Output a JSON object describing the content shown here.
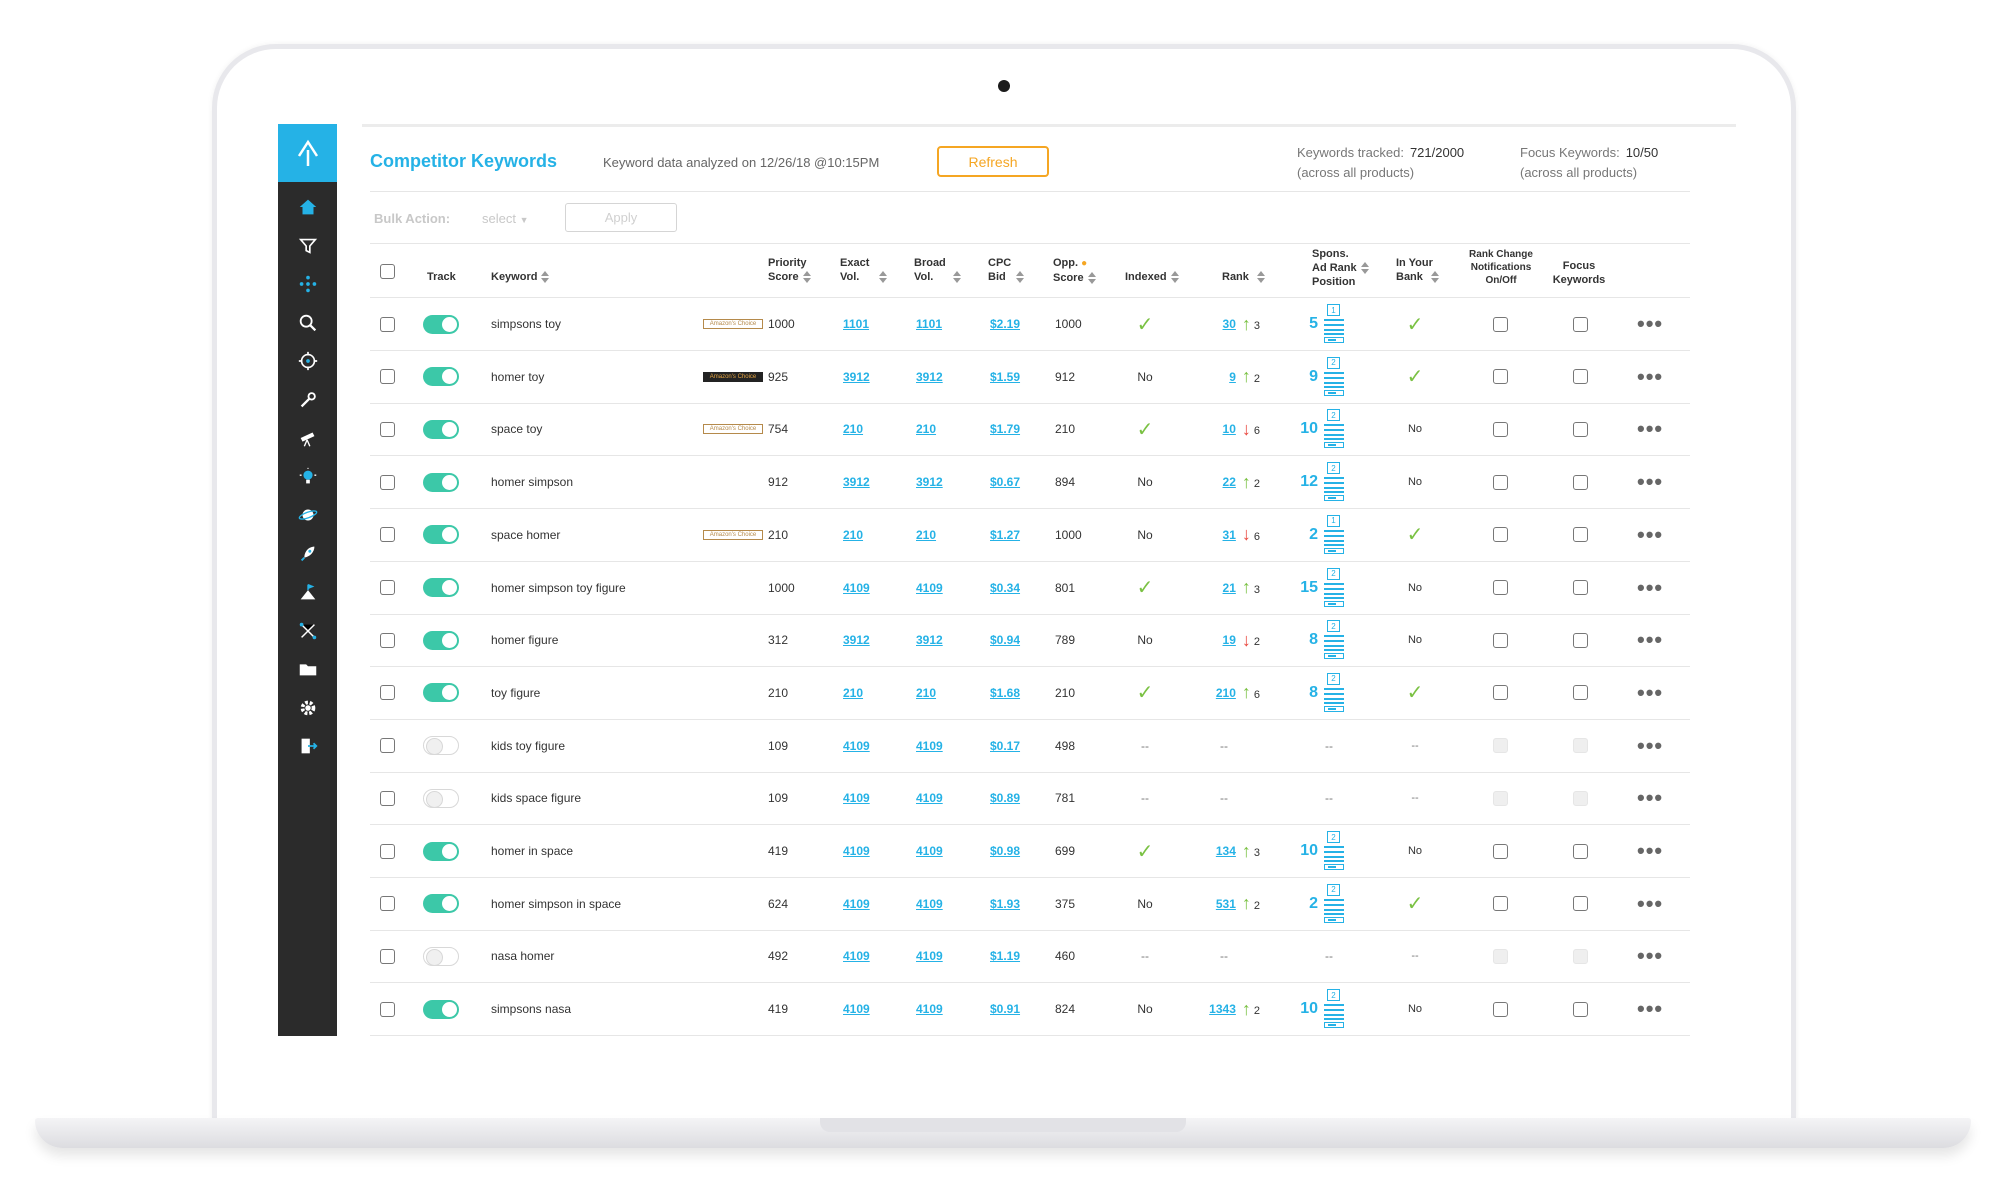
{
  "app": {
    "title": "Competitor Keywords",
    "analyzed": "Keyword data analyzed on 12/26/18 @10:15PM",
    "refresh_label": "Refresh",
    "keywords_tracked_label": "Keywords tracked:",
    "keywords_tracked_value": "721/2000",
    "keywords_tracked_note": "(across all products)",
    "focus_keywords_label": "Focus Keywords:",
    "focus_keywords_value": "10/50",
    "focus_keywords_note": "(across all products)",
    "bulk_action_label": "Bulk Action:",
    "bulk_select_label": "select",
    "apply_label": "Apply"
  },
  "colors": {
    "accent": "#25b2e6",
    "toggle_on": "#3cc8a8",
    "refresh": "#f5a623",
    "check": "#7ac143",
    "down": "#e8453c",
    "sidebar": "#2b2b2b"
  },
  "sidebar_icons": [
    "logo-icon",
    "home-icon",
    "funnel-icon",
    "diamond-dots-icon",
    "search-icon",
    "crosshair-icon",
    "wrench-icon",
    "telescope-icon",
    "lightbulb-icon",
    "planet-icon",
    "rocket-icon",
    "flag-icon",
    "network-icon",
    "folder-icon",
    "gear-icon",
    "logout-icon"
  ],
  "headers": {
    "track": "Track",
    "keyword": "Keyword",
    "priority_1": "Priority",
    "priority_2": "Score",
    "exact_1": "Exact",
    "exact_2": "Vol.",
    "broad_1": "Broad",
    "broad_2": "Vol.",
    "cpc_1": "CPC",
    "cpc_2": "Bid",
    "opp_1": "Opp.",
    "opp_2": "Score",
    "indexed": "Indexed",
    "rank": "Rank",
    "spons_1": "Spons.",
    "spons_2": "Ad Rank",
    "spons_3": "Position",
    "bank_1": "In Your",
    "bank_2": "Bank",
    "notif_1": "Rank Change",
    "notif_2": "Notifications",
    "notif_3": "On/Off",
    "focus_1": "Focus",
    "focus_2": "Keywords"
  },
  "badge_text": "Amazon's Choice",
  "rows": [
    {
      "track": true,
      "keyword": "simpsons toy",
      "badge": "light",
      "priority": "1000",
      "exact": "1101",
      "broad": "1101",
      "cpc": "$2.19",
      "opp": "1000",
      "indexed": "check",
      "rank": "30",
      "dir": "up",
      "delta": "3",
      "spons": "5",
      "pos": "1",
      "bank": "check"
    },
    {
      "track": true,
      "keyword": "homer toy",
      "badge": "dark",
      "priority": "925",
      "exact": "3912",
      "broad": "3912",
      "cpc": "$1.59",
      "opp": "912",
      "indexed": "No",
      "rank": "9",
      "dir": "up",
      "delta": "2",
      "spons": "9",
      "pos": "2",
      "bank": "check"
    },
    {
      "track": true,
      "keyword": "space toy",
      "badge": "light",
      "priority": "754",
      "exact": "210",
      "broad": "210",
      "cpc": "$1.79",
      "opp": "210",
      "indexed": "check",
      "rank": "10",
      "dir": "down",
      "delta": "6",
      "spons": "10",
      "pos": "2",
      "bank": "No"
    },
    {
      "track": true,
      "keyword": "homer simpson",
      "badge": "",
      "priority": "912",
      "exact": "3912",
      "broad": "3912",
      "cpc": "$0.67",
      "opp": "894",
      "indexed": "No",
      "rank": "22",
      "dir": "up",
      "delta": "2",
      "spons": "12",
      "pos": "2",
      "bank": "No"
    },
    {
      "track": true,
      "keyword": "space homer",
      "badge": "light",
      "priority": "210",
      "exact": "210",
      "broad": "210",
      "cpc": "$1.27",
      "opp": "1000",
      "indexed": "No",
      "rank": "31",
      "dir": "down",
      "delta": "6",
      "spons": "2",
      "pos": "1",
      "bank": "check"
    },
    {
      "track": true,
      "keyword": "homer simpson toy figure",
      "badge": "",
      "priority": "1000",
      "exact": "4109",
      "broad": "4109",
      "cpc": "$0.34",
      "opp": "801",
      "indexed": "check",
      "rank": "21",
      "dir": "up",
      "delta": "3",
      "spons": "15",
      "pos": "2",
      "bank": "No"
    },
    {
      "track": true,
      "keyword": "homer figure",
      "badge": "",
      "priority": "312",
      "exact": "3912",
      "broad": "3912",
      "cpc": "$0.94",
      "opp": "789",
      "indexed": "No",
      "rank": "19",
      "dir": "down",
      "delta": "2",
      "spons": "8",
      "pos": "2",
      "bank": "No"
    },
    {
      "track": true,
      "keyword": "toy figure",
      "badge": "",
      "priority": "210",
      "exact": "210",
      "broad": "210",
      "cpc": "$1.68",
      "opp": "210",
      "indexed": "check",
      "rank": "210",
      "dir": "up",
      "delta": "6",
      "spons": "8",
      "pos": "2",
      "bank": "check"
    },
    {
      "track": false,
      "keyword": "kids toy figure",
      "badge": "",
      "priority": "109",
      "exact": "4109",
      "broad": "4109",
      "cpc": "$0.17",
      "opp": "498",
      "indexed": "--",
      "rank": "--",
      "dir": "",
      "delta": "",
      "spons": "--",
      "pos": "",
      "bank": "--"
    },
    {
      "track": false,
      "keyword": "kids space figure",
      "badge": "",
      "priority": "109",
      "exact": "4109",
      "broad": "4109",
      "cpc": "$0.89",
      "opp": "781",
      "indexed": "--",
      "rank": "--",
      "dir": "",
      "delta": "",
      "spons": "--",
      "pos": "",
      "bank": "--"
    },
    {
      "track": true,
      "keyword": "homer in space",
      "badge": "",
      "priority": "419",
      "exact": "4109",
      "broad": "4109",
      "cpc": "$0.98",
      "opp": "699",
      "indexed": "check",
      "rank": "134",
      "dir": "up",
      "delta": "3",
      "spons": "10",
      "pos": "2",
      "bank": "No"
    },
    {
      "track": true,
      "keyword": "homer simpson in space",
      "badge": "",
      "priority": "624",
      "exact": "4109",
      "broad": "4109",
      "cpc": "$1.93",
      "opp": "375",
      "indexed": "No",
      "rank": "531",
      "dir": "up",
      "delta": "2",
      "spons": "2",
      "pos": "2",
      "bank": "check"
    },
    {
      "track": false,
      "keyword": "nasa homer",
      "badge": "",
      "priority": "492",
      "exact": "4109",
      "broad": "4109",
      "cpc": "$1.19",
      "opp": "460",
      "indexed": "--",
      "rank": "--",
      "dir": "",
      "delta": "",
      "spons": "--",
      "pos": "",
      "bank": "--"
    },
    {
      "track": true,
      "keyword": "simpsons nasa",
      "badge": "",
      "priority": "419",
      "exact": "4109",
      "broad": "4109",
      "cpc": "$0.91",
      "opp": "824",
      "indexed": "No",
      "rank": "1343",
      "dir": "up",
      "delta": "2",
      "spons": "10",
      "pos": "2",
      "bank": "No"
    }
  ]
}
